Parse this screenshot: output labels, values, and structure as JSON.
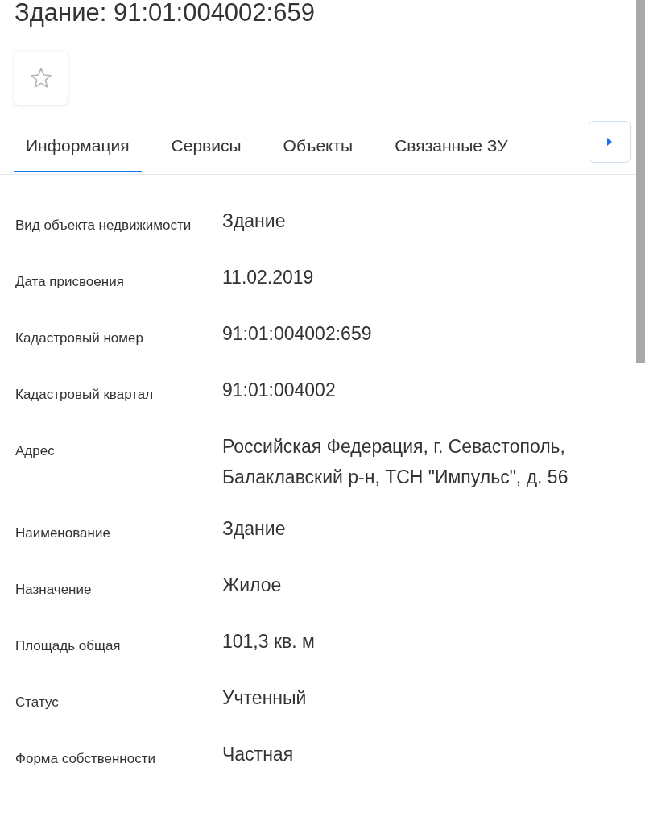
{
  "title": "Здание: 91:01:004002:659",
  "favorite": {
    "starred": false
  },
  "tabs": [
    {
      "label": "Информация",
      "selected": true
    },
    {
      "label": "Сервисы",
      "selected": false
    },
    {
      "label": "Объекты",
      "selected": false
    },
    {
      "label": "Связанные ЗУ",
      "selected": false
    }
  ],
  "fields": [
    {
      "label": "Вид объекта недвижимости",
      "value": "Здание"
    },
    {
      "label": "Дата присвоения",
      "value": "11.02.2019"
    },
    {
      "label": "Кадастровый номер",
      "value": "91:01:004002:659"
    },
    {
      "label": "Кадастровый квартал",
      "value": "91:01:004002"
    },
    {
      "label": "Адрес",
      "value": "Российская Федерация, г. Севастополь, Балаклавский р-н, ТСН \"Импульс\", д. 56"
    },
    {
      "label": "Наименование",
      "value": "Здание"
    },
    {
      "label": "Назначение",
      "value": "Жилое"
    },
    {
      "label": "Площадь общая",
      "value": "101,3 кв. м"
    },
    {
      "label": "Статус",
      "value": "Учтенный"
    },
    {
      "label": "Форма собственности",
      "value": "Частная"
    }
  ]
}
